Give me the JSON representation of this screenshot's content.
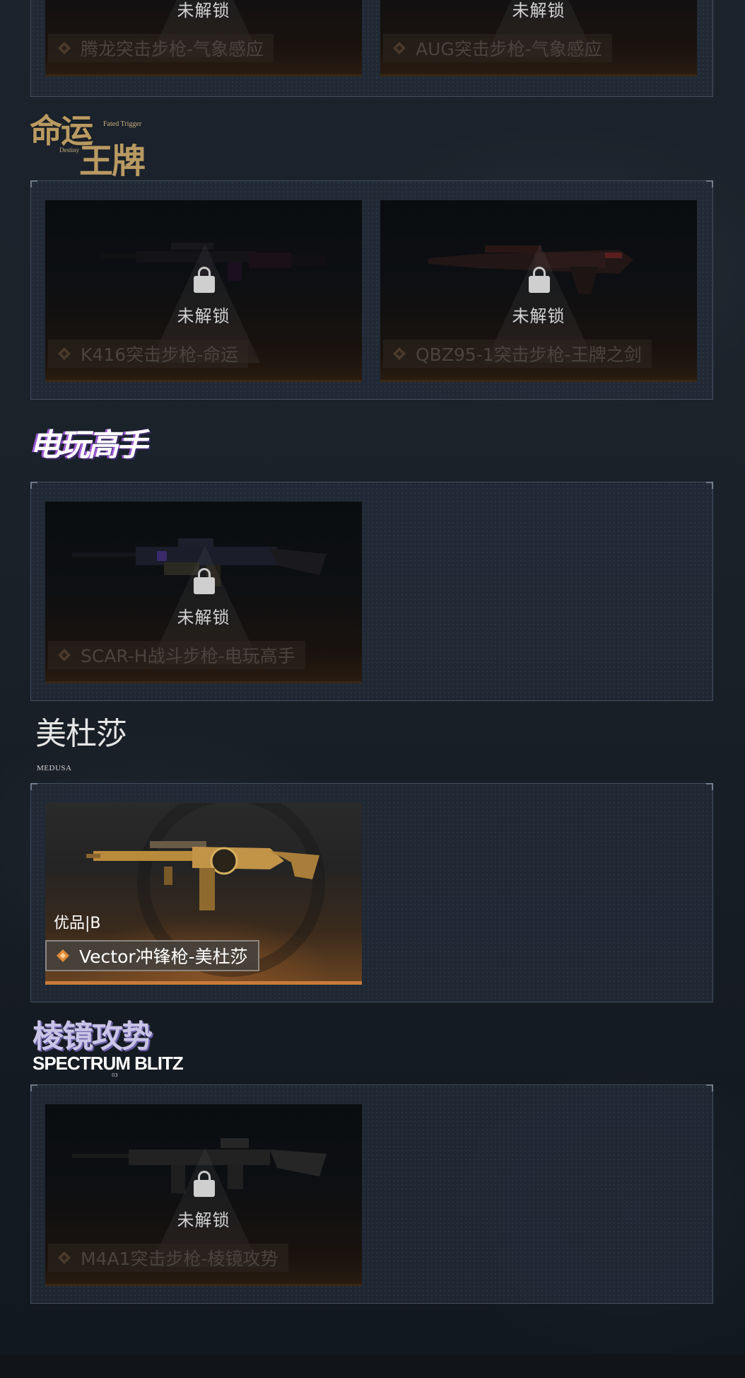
{
  "status": {
    "locked": "未解锁"
  },
  "sections": [
    {
      "id": "weather",
      "cards": [
        {
          "name": "腾龙突击步枪-气象感应",
          "locked": true
        },
        {
          "name": "AUG突击步枪-气象感应",
          "locked": true
        }
      ]
    },
    {
      "id": "fate",
      "logo": {
        "main": "命运",
        "sub": "王牌",
        "en1": "Fated Trigger",
        "en2": "Destiny"
      },
      "cards": [
        {
          "name": "K416突击步枪-命运",
          "locked": true
        },
        {
          "name": "QBZ95-1突击步枪-王牌之剑",
          "locked": true
        }
      ]
    },
    {
      "id": "gamer",
      "logo": {
        "main": "电玩高手"
      },
      "cards": [
        {
          "name": "SCAR-H战斗步枪-电玩高手",
          "locked": true
        }
      ]
    },
    {
      "id": "medusa",
      "logo": {
        "main": "美杜莎",
        "en": "MEDUSA"
      },
      "cards": [
        {
          "name": "Vector冲锋枪-美杜莎",
          "locked": false,
          "grade": "优品|B"
        }
      ]
    },
    {
      "id": "spectrum",
      "logo": {
        "main": "棱镜攻势",
        "en": "SPECTRUM BLITZ",
        "tiny": "03"
      },
      "cards": [
        {
          "name": "M4A1突击步枪-棱镜攻势",
          "locked": true
        }
      ]
    }
  ],
  "colors": {
    "accent_orange": "#c97a3a",
    "logo_gold": "#b99a62",
    "locked_text": "#d4d4d4"
  }
}
